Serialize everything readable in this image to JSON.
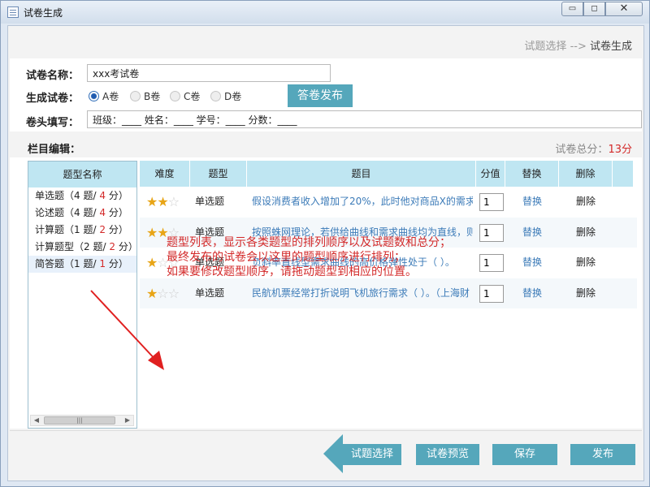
{
  "window": {
    "title": "试卷生成",
    "minimize_glyph": "▭",
    "maximize_glyph": "◻",
    "close_glyph": "✕"
  },
  "breadcrumb": {
    "step1": "试题选择",
    "arrow": "-->",
    "step2": "试卷生成"
  },
  "form": {
    "name_label": "试卷名称：",
    "name_value": "xxx考试卷",
    "generate_label": "生成试卷：",
    "papers": [
      {
        "label": "A卷",
        "checked": true
      },
      {
        "label": "B卷",
        "checked": false
      },
      {
        "label": "C卷",
        "checked": false
      },
      {
        "label": "D卷",
        "checked": false
      }
    ],
    "publish_label": "答卷发布",
    "header_label": "卷头填写：",
    "header_value": "班级：____  姓名：____  学号：____  分数：____"
  },
  "editor": {
    "section_label": "栏目编辑：",
    "total_label": "试卷总分：",
    "total_value": "13",
    "total_unit": "分",
    "type_header": "题型名称",
    "types": [
      {
        "name": "单选题",
        "count": "4",
        "score": "4",
        "selected": false
      },
      {
        "name": "论述题",
        "count": "4",
        "score": "4",
        "selected": false
      },
      {
        "name": "计算题",
        "count": "1",
        "score": "2",
        "selected": false
      },
      {
        "name": "计算题型",
        "count": "2",
        "score": "2",
        "selected": false
      },
      {
        "name": "简答题",
        "count": "1",
        "score": "1",
        "selected": true
      }
    ],
    "scroll_thumb_glyph": "|||",
    "columns": {
      "difficulty": "难度",
      "type": "题型",
      "question": "题目",
      "score": "分值",
      "replace": "替换",
      "delete": "删除"
    },
    "questions": [
      {
        "difficulty": 2,
        "type": "单选题",
        "text": "假设消费者收入增加了20%，此时他对商品X的需求",
        "score": "1",
        "replace": "替换",
        "delete": "删除"
      },
      {
        "difficulty": 2,
        "type": "单选题",
        "text": "按照蛛网理论，若供给曲线和需求曲线均为直线，则",
        "score": "1",
        "replace": "替换",
        "delete": "删除"
      },
      {
        "difficulty": 1,
        "type": "单选题",
        "text": "负斜率直线型需求曲线的高价格弹性处于（ ）。",
        "score": "1",
        "replace": "替换",
        "delete": "删除"
      },
      {
        "difficulty": 1,
        "type": "单选题",
        "text": "民航机票经常打折说明飞机旅行需求（ ）。（上海财",
        "score": "1",
        "replace": "替换",
        "delete": "删除"
      }
    ]
  },
  "annotation": {
    "lines": [
      "题型列表，显示各类题型的排列顺序以及试题数和总分；",
      "最终发布的试卷会以这里的题型顺序进行排列；",
      "如果要修改题型顺序，请拖动题型到相应的位置。"
    ]
  },
  "footer": {
    "back_label": "试题选择",
    "preview_label": "试卷预览",
    "save_label": "保存",
    "publish_label": "发布"
  },
  "colors": {
    "accent": "#55a7bb",
    "header_bg": "#bfe6f2",
    "link": "#3c7bb8",
    "highlight": "#d32a2a",
    "star": "#e8a517"
  }
}
